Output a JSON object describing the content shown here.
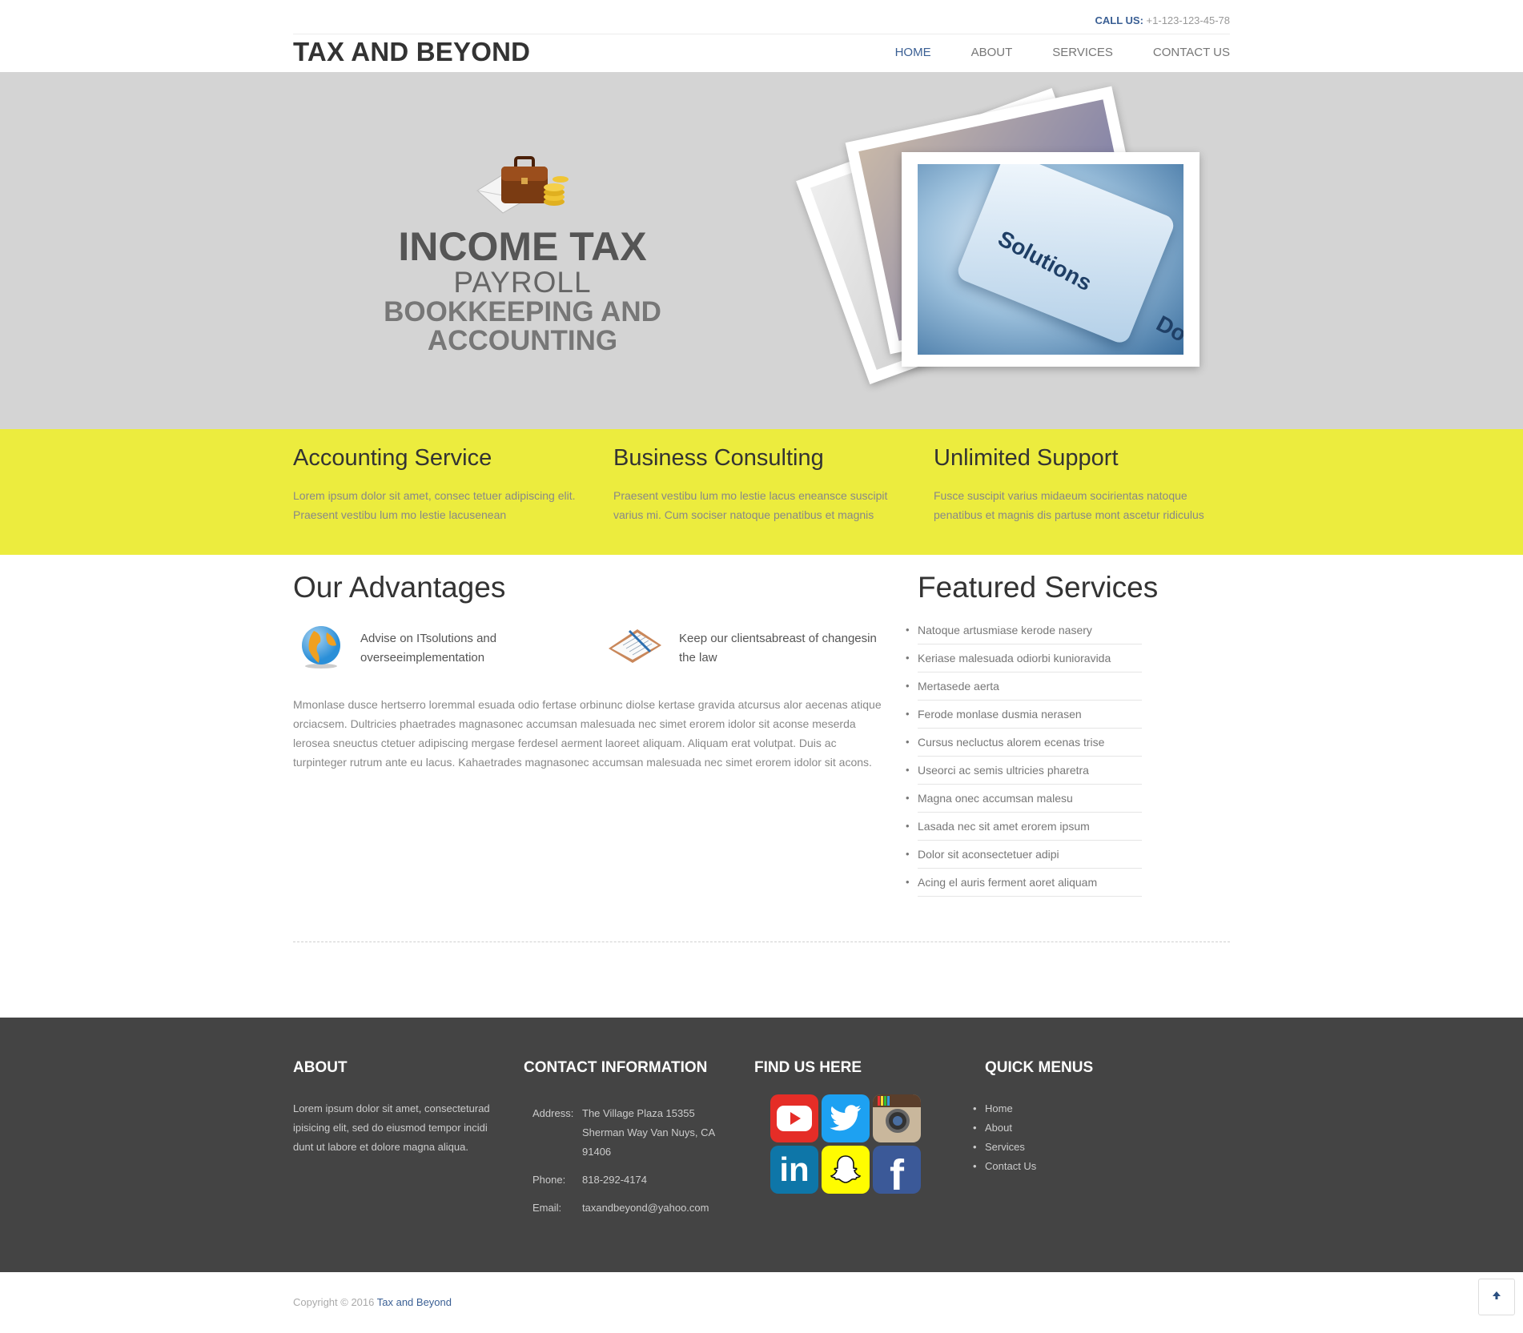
{
  "header": {
    "call_label": "CALL US:",
    "call_number": "+1-123-123-45-78",
    "logo": "TAX AND BEYOND",
    "nav": [
      {
        "label": "HOME",
        "active": true
      },
      {
        "label": "ABOUT",
        "active": false
      },
      {
        "label": "SERVICES",
        "active": false
      },
      {
        "label": "CONTACT US",
        "active": false
      }
    ]
  },
  "hero": {
    "line1": "INCOME TAX",
    "line2": "PAYROLL",
    "line3": "BOOKKEEPING AND",
    "line4": "ACCOUNTING",
    "photo_caption": "Solutions",
    "photo_caption_partial": "Do"
  },
  "features": [
    {
      "title": "Accounting Service",
      "text": "Lorem ipsum dolor sit amet, consec tetuer adipiscing elit. Praesent vestibu lum mo lestie lacusenean"
    },
    {
      "title": "Business Consulting",
      "text": "Praesent vestibu lum mo lestie lacus eneansce suscipit varius mi. Cum sociser natoque penatibus et magnis"
    },
    {
      "title": "Unlimited Support",
      "text": "Fusce suscipit varius midaeum socirientas natoque penatibus et magnis dis partuse mont ascetur ridiculus"
    }
  ],
  "advantages": {
    "title": "Our Advantages",
    "items": [
      {
        "icon": "globe-icon",
        "text": "Advise on ITsolutions and overseeimplementation"
      },
      {
        "icon": "clipboard-icon",
        "text": "Keep our clientsabreast of changesin the law"
      }
    ],
    "paragraph": "Mmonlase dusce hertserro loremmal esuada odio fertase orbinunc diolse kertase gravida atcursus alor aecenas atique orciacsem. Dultricies phaetrades magnasonec accumsan malesuada nec simet erorem idolor sit aconse meserda lerosea sneuctus ctetuer adipiscing mergase ferdesel aerment laoreet aliquam. Aliquam erat volutpat. Duis ac turpinteger rutrum ante eu lacus. Kahaetrades magnasonec accumsan malesuada nec simet erorem idolor sit acons."
  },
  "featured_services": {
    "title": "Featured Services",
    "items": [
      "Natoque artusmiase kerode nasery",
      "Keriase malesuada odiorbi kunioravida",
      "Mertasede aerta",
      "Ferode monlase dusmia nerasen",
      "Cursus necluctus alorem ecenas trise",
      "Useorci ac semis ultricies pharetra",
      "Magna onec accumsan malesu",
      "Lasada nec sit amet erorem ipsum",
      "Dolor sit aconsectetuer adipi",
      "Acing el auris ferment aoret aliquam"
    ]
  },
  "footer": {
    "about_title": "ABOUT",
    "about_text": "Lorem ipsum dolor sit amet, consecteturad ipisicing elit, sed do eiusmod tempor incidi dunt ut labore et dolore magna aliqua.",
    "contact_title": "CONTACT INFORMATION",
    "address_label": "Address:",
    "address_value": "The Village Plaza 15355 Sherman Way Van Nuys, CA 91406",
    "phone_label": "Phone:",
    "phone_value": "818-292-4174",
    "email_label": "Email:",
    "email_value": "taxandbeyond@yahoo.com",
    "find_title": "FIND US HERE",
    "social": [
      {
        "name": "youtube-icon",
        "color": "#e52d27"
      },
      {
        "name": "twitter-icon",
        "color": "#1da1f2"
      },
      {
        "name": "instagram-icon",
        "color": "#c9b79c"
      },
      {
        "name": "linkedin-icon",
        "color": "#0e76a8"
      },
      {
        "name": "snapchat-icon",
        "color": "#fffc00"
      },
      {
        "name": "facebook-icon",
        "color": "#3b5998"
      }
    ],
    "quick_title": "QUICK MENUS",
    "quick_menu": [
      "Home",
      "About",
      "Services",
      "Contact Us"
    ]
  },
  "copyright": {
    "text": "Copyright © 2016 ",
    "brand": "Tax and Beyond"
  },
  "colors": {
    "accent_blue": "#3a5f94",
    "yellow_band": "#ecec3e",
    "hero_bg": "#d4d4d4",
    "footer_bg": "#444444"
  }
}
